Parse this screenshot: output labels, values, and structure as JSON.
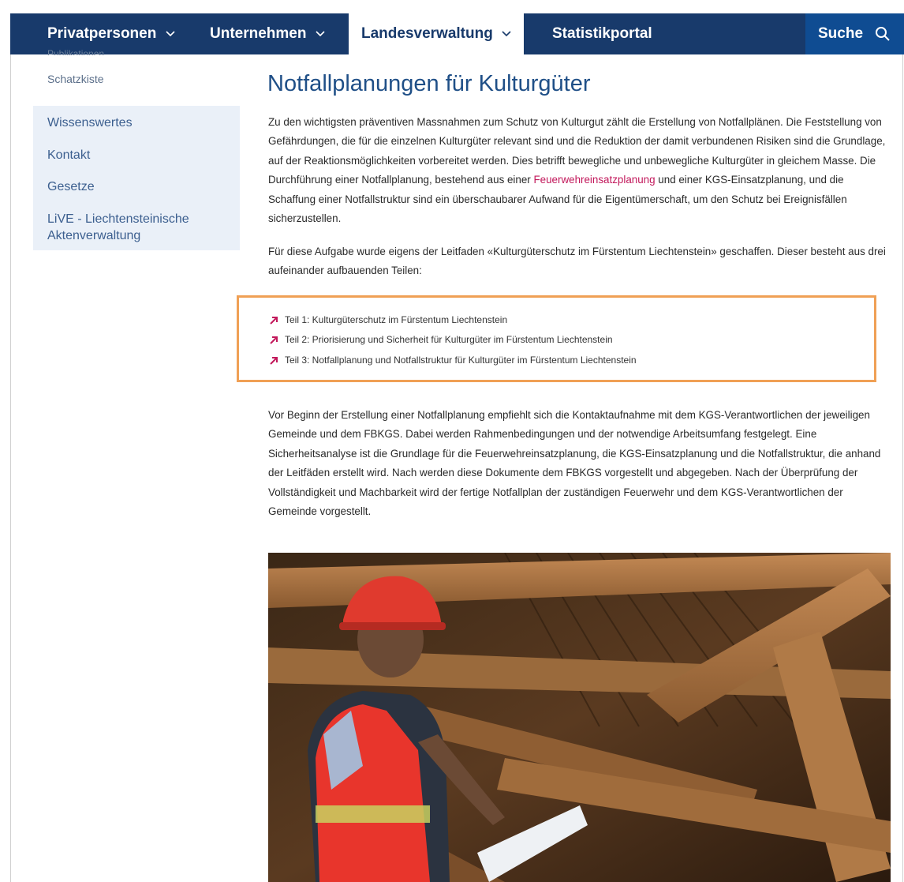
{
  "nav": {
    "items": [
      {
        "label": "Privatpersonen"
      },
      {
        "label": "Unternehmen"
      },
      {
        "label": "Landesverwaltung"
      },
      {
        "label": "Statistikportal"
      }
    ],
    "search_label": "Suche"
  },
  "sidebar": {
    "cut_item": "Publikationen",
    "small_item": "Schatzkiste",
    "items": [
      {
        "label": "Wissenswertes"
      },
      {
        "label": "Kontakt"
      },
      {
        "label": "Gesetze"
      },
      {
        "label": "LiVE - Liechtensteinische Aktenverwaltung"
      }
    ]
  },
  "main": {
    "title": "Notfallplanungen für Kulturgüter",
    "p1_before_link": "Zu den wichtigsten präventiven Massnahmen zum Schutz von Kulturgut zählt die Erstellung von Notfallplänen. Die Feststellung von Gefährdungen, die für die einzelnen Kulturgüter relevant sind und die Reduktion der damit verbundenen Risiken sind die Grundlage, auf der Reaktionsmöglichkeiten vorbereitet werden. Dies betrifft bewegliche und unbewegliche Kulturgüter in gleichem Masse. Die Durchführung einer Notfallplanung, bestehend aus einer ",
    "p1_link": "Feuerwehreinsatzplanung",
    "p1_after_link": " und einer KGS-Einsatzplanung, und die Schaffung einer Notfallstruktur sind ein überschaubarer Aufwand für die Eigentümerschaft, um den Schutz bei Ereignisfällen sicherzustellen.",
    "p2": "Für diese Aufgabe wurde eigens der Leitfaden «Kulturgüterschutz im Fürstentum Liechtenstein» geschaffen. Dieser besteht aus drei aufeinander aufbauenden Teilen:",
    "downloads": [
      {
        "label": "Teil 1: Kulturgüterschutz im Fürstentum Liechtenstein"
      },
      {
        "label": "Teil 2: Priorisierung und Sicherheit für Kulturgüter im Fürstentum Liechtenstein"
      },
      {
        "label": "Teil 3: Notfallplanung und Notfallstruktur für Kulturgüter im Fürstentum Liechtenstein"
      }
    ],
    "p3": "Vor Beginn der Erstellung einer Notfallplanung empfiehlt sich die Kontaktaufnahme mit dem KGS-Verantwortlichen der jeweiligen Gemeinde und dem FBKGS. Dabei werden Rahmenbedingungen und der notwendige Arbeitsumfang festgelegt. Eine Sicherheitsanalyse ist die Grundlage für die Feuerwehreinsatzplanung, die KGS-Einsatzplanung und die Notfallstruktur, die anhand der Leitfäden erstellt wird. Nach werden diese Dokumente dem FBKGS vorgestellt und abgegeben. Nach der Überprüfung der Vollständigkeit und Machbarkeit wird der fertige Notfallplan der zuständigen Feuerwehr und dem KGS-Verantwortlichen der Gemeinde vorgestellt."
  },
  "colors": {
    "nav_bg": "#183a6b",
    "search_bg": "#0f4c92",
    "title": "#1f4f87",
    "link": "#c2185b",
    "highlight_border": "#f0a055",
    "sidebar_bg": "#eaf0f8"
  }
}
